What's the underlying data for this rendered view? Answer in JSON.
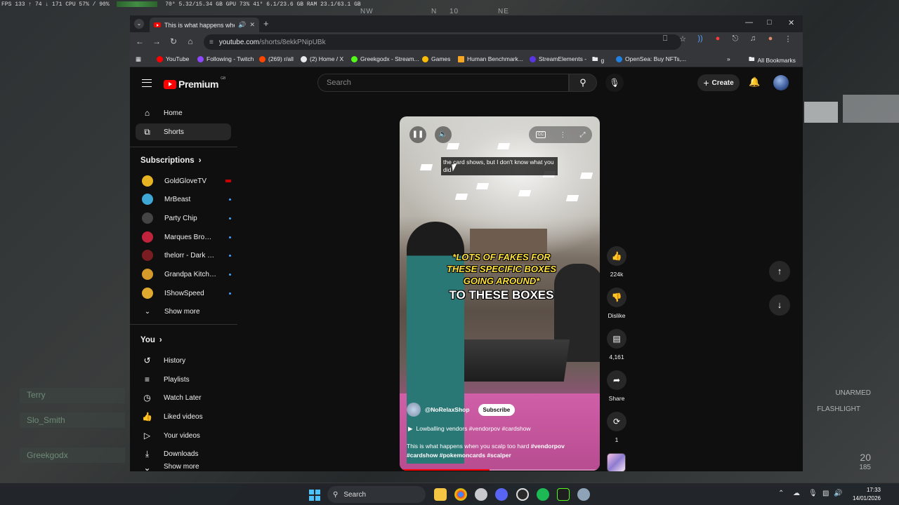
{
  "hud": {
    "stats_text": "FPS 133 ↑ 74 ↓ 171    CPU 57% / 90%",
    "temps_text": "70°  5.32/15.34 GB  GPU 73%  41°  6.1/23.6 GB  RAM 23.1/63.1 GB",
    "compass": [
      "NW",
      "N",
      "10",
      "NE"
    ],
    "team": [
      "Terry",
      "Slo_Smith",
      "Greekgodx"
    ],
    "right_labels": [
      "UNARMED",
      "FLASHLIGHT",
      "20",
      "185"
    ]
  },
  "browser": {
    "tab_title": "This is what happens when you scalp too hard",
    "url_host": "youtube.com",
    "url_path": "/shorts/8ekkPNipUBk",
    "bookmarks": [
      {
        "label": "YouTube",
        "color": "#ff0000"
      },
      {
        "label": "Following - Twitch",
        "color": "#9146ff"
      },
      {
        "label": "(269) r/all",
        "color": "#ff4500"
      },
      {
        "label": "(2) Home / X",
        "color": "#e7e9ea"
      },
      {
        "label": "Greekgodx - Stream...",
        "color": "#53fc18"
      },
      {
        "label": "Games",
        "color": "#fbbc05"
      },
      {
        "label": "Human Benchmark...",
        "color": "#f5a623"
      },
      {
        "label": "StreamElements -",
        "color": "#5a35e6"
      },
      {
        "label": "g",
        "color": "#8a8a8a"
      },
      {
        "label": "OpenSea: Buy NFTs,...",
        "color": "#2081e2"
      }
    ],
    "all_bookmarks": "All Bookmarks"
  },
  "yt": {
    "logo_text": "Premium",
    "region": "GB",
    "search_placeholder": "Search",
    "create_label": "Create",
    "nav": [
      {
        "label": "Home",
        "icon": "home-icon"
      },
      {
        "label": "Shorts",
        "icon": "shorts-icon"
      }
    ],
    "subscriptions_title": "Subscriptions",
    "subscriptions": [
      {
        "name": "GoldGloveTV",
        "color": "#e6b422",
        "status": "live"
      },
      {
        "name": "MrBeast",
        "color": "#3fa7d6",
        "status": "new"
      },
      {
        "name": "Party Chip",
        "color": "#2b2b2b",
        "status": "new"
      },
      {
        "name": "Marques Brownlee",
        "color": "#c0233b",
        "status": "new"
      },
      {
        "name": "thelorr - Dark and Darker",
        "color": "#7a1d22",
        "status": "new"
      },
      {
        "name": "Grandpa Kitchen",
        "color": "#d49a2a",
        "status": "new"
      },
      {
        "name": "IShowSpeed",
        "color": "#e0a930",
        "status": "new"
      }
    ],
    "show_more": "Show more",
    "you_title": "You",
    "you_items": [
      {
        "label": "History",
        "icon": "history-icon"
      },
      {
        "label": "Playlists",
        "icon": "playlists-icon"
      },
      {
        "label": "Watch Later",
        "icon": "watch-later-icon"
      },
      {
        "label": "Liked videos",
        "icon": "liked-videos-icon"
      },
      {
        "label": "Your videos",
        "icon": "your-videos-icon"
      },
      {
        "label": "Downloads",
        "icon": "downloads-icon"
      }
    ],
    "you_show_more": "Show more",
    "short": {
      "caption": "the card shows, but I don't know what you did",
      "overlay_lines": [
        "*LOTS OF FAKES FOR",
        "THESE SPECIFIC BOXES",
        "GOING AROUND*"
      ],
      "overlay_bottom": "TO THESE BOXES",
      "channel": "@NoRelaxShop",
      "subscribe_label": "Subscribe",
      "sound": "Lowballing vendors #vendorpov #cardshow",
      "description_plain": "This is what happens when you scalp too hard ",
      "description_tags_1": "#vendorpov",
      "description_tags_2": "#cardshow #pokemoncards #scalper",
      "progress": 0.45
    },
    "actions": {
      "likes": "224k",
      "dislike": "Dislike",
      "comments": "4,161",
      "share": "Share",
      "remix": "1"
    }
  },
  "taskbar": {
    "search_label": "Search",
    "time": "17:33",
    "date": "14/01/2026"
  }
}
